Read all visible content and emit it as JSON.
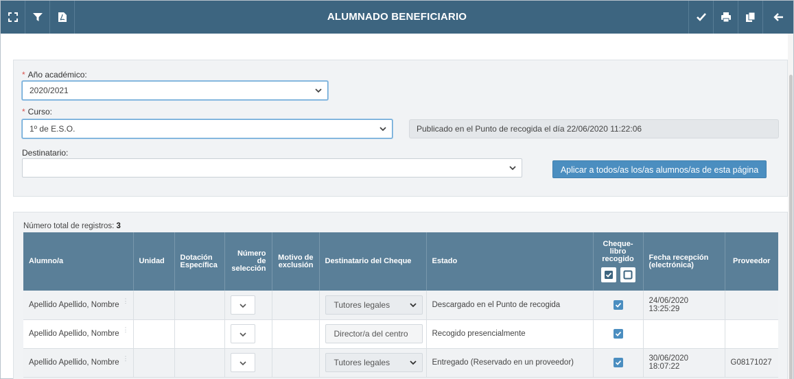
{
  "header": {
    "title": "ALUMNADO BENEFICIARIO",
    "left_icons": [
      "expand-icon",
      "filter-icon",
      "pdf-icon"
    ],
    "right_icons": [
      "check-icon",
      "print-icon",
      "copy-icon",
      "back-arrow-icon"
    ]
  },
  "filters": {
    "academic_year_label": "Año académico:",
    "academic_year_value": "2020/2021",
    "course_label": "Curso:",
    "course_value": "1º de E.S.O.",
    "published_text": "Publicado en el Punto de recogida el día 22/06/2020 11:22:06",
    "recipient_label": "Destinatario:",
    "recipient_value": "",
    "apply_button": "Aplicar a todos/as los/as alumnos/as de esta página",
    "required_mark": "*"
  },
  "list": {
    "total_label": "Número total de registros:",
    "total_count": "3",
    "columns": {
      "student": "Alumno/a",
      "unit": "Unidad",
      "allocation": "Dotación Específica",
      "selection_number": "Número de selección",
      "exclusion_reason": "Motivo de exclusión",
      "recipient": "Destinatario del Cheque",
      "status": "Estado",
      "collected": "Cheque-libro recogido",
      "reception_date": "Fecha recepción (electrónica)",
      "provider": "Proveedor"
    },
    "rows": [
      {
        "student": "Apellido Apellido, Nombre",
        "unit": "",
        "allocation": "",
        "selection_number": "",
        "exclusion_reason": "",
        "recipient": "Tutores legales",
        "recipient_is_select": true,
        "status": "Descargado en el Punto de recogida",
        "collected": true,
        "reception_date": "24/06/2020 13:25:29",
        "provider": ""
      },
      {
        "student": "Apellido Apellido, Nombre",
        "unit": "",
        "allocation": "",
        "selection_number": "",
        "exclusion_reason": "",
        "recipient": "Director/a del centro",
        "recipient_is_select": false,
        "status": "Recogido presencialmente",
        "collected": true,
        "reception_date": "",
        "provider": ""
      },
      {
        "student": "Apellido Apellido, Nombre",
        "unit": "",
        "allocation": "",
        "selection_number": "",
        "exclusion_reason": "",
        "recipient": "Tutores legales",
        "recipient_is_select": true,
        "status": "Entregado (Reservado en un proveedor)",
        "collected": true,
        "reception_date": "30/06/2020 18:07:22",
        "provider": "G08171027"
      }
    ]
  },
  "colors": {
    "topbar": "#3d6580",
    "table_header": "#5a7f98",
    "accent": "#4b8ec0",
    "required": "#d9534f"
  }
}
